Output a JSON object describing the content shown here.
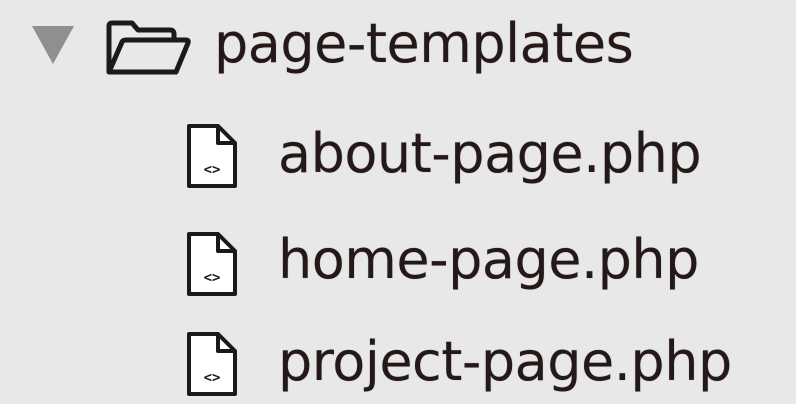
{
  "tree": {
    "folder": {
      "name": "page-templates",
      "expanded": true,
      "icon": "folder-open-icon",
      "disclosure_icon": "disclosure-triangle-down-icon"
    },
    "files": [
      {
        "name": "about-page.php",
        "icon": "php-file-icon"
      },
      {
        "name": "home-page.php",
        "icon": "php-file-icon"
      },
      {
        "name": "project-page.php",
        "icon": "php-file-icon"
      }
    ]
  },
  "colors": {
    "background": "#e8e8e8",
    "text": "#241818",
    "disclosure": "#8f8f8f",
    "icon_stroke": "#1a1a1a"
  }
}
